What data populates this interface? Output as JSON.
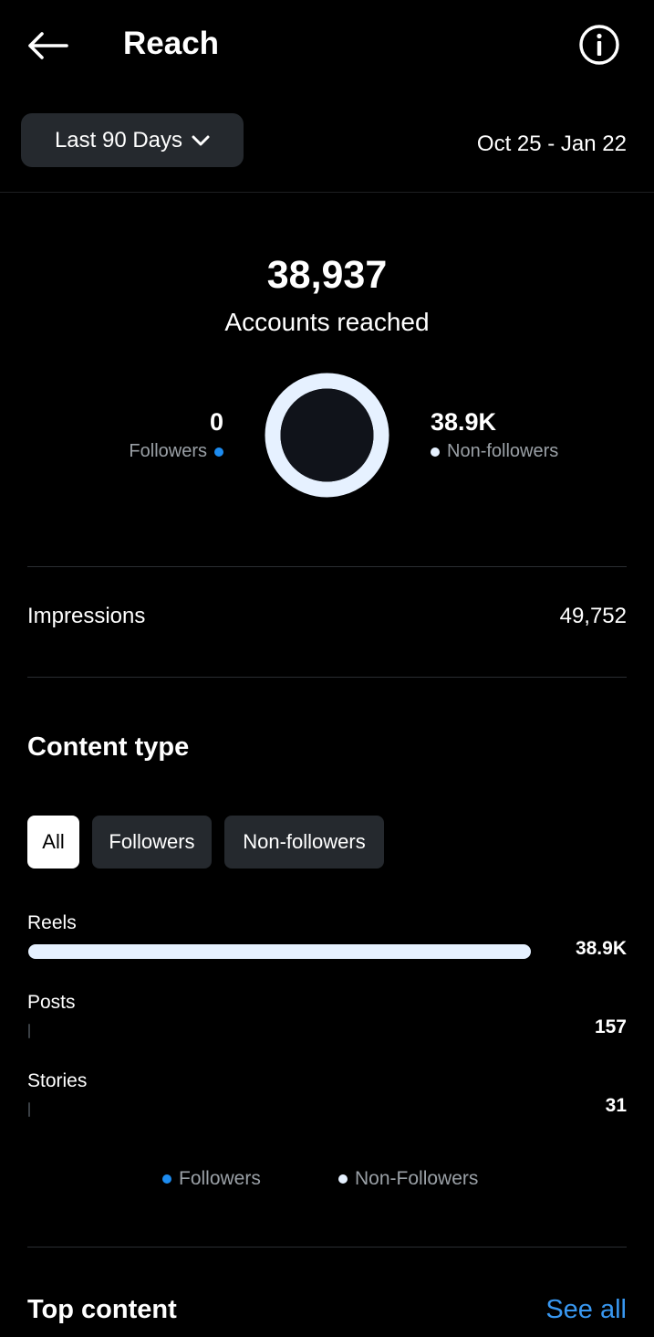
{
  "header": {
    "title": "Reach",
    "back_icon": "arrow-left-icon",
    "info_icon": "info-circle-icon"
  },
  "range": {
    "selected": "Last 90 Days",
    "date_range": "Oct 25 - Jan 22"
  },
  "summary": {
    "accounts_reached": "38,937",
    "caption": "Accounts reached",
    "followers": {
      "value": "0",
      "label": "Followers",
      "color": "#1d8cf0"
    },
    "non_followers": {
      "value": "38.9K",
      "label": "Non-followers",
      "color": "#e6f1ff"
    },
    "donut": {
      "followers_share": 0,
      "non_followers_share": 1
    }
  },
  "impressions": {
    "label": "Impressions",
    "value": "49,752"
  },
  "content_type": {
    "title": "Content type",
    "filters": [
      {
        "label": "All",
        "selected": true
      },
      {
        "label": "Followers",
        "selected": false
      },
      {
        "label": "Non-followers",
        "selected": false
      }
    ],
    "rows": [
      {
        "label": "Reels",
        "value": "38.9K",
        "share": 1.0
      },
      {
        "label": "Posts",
        "value": "157",
        "share": 0.004
      },
      {
        "label": "Stories",
        "value": "31",
        "share": 0.001
      }
    ],
    "legend": [
      {
        "label": "Followers",
        "color": "#1d8cf0"
      },
      {
        "label": "Non-Followers",
        "color": "#e6f1ff"
      }
    ]
  },
  "top_content": {
    "title": "Top content",
    "see_all": "See all"
  }
}
